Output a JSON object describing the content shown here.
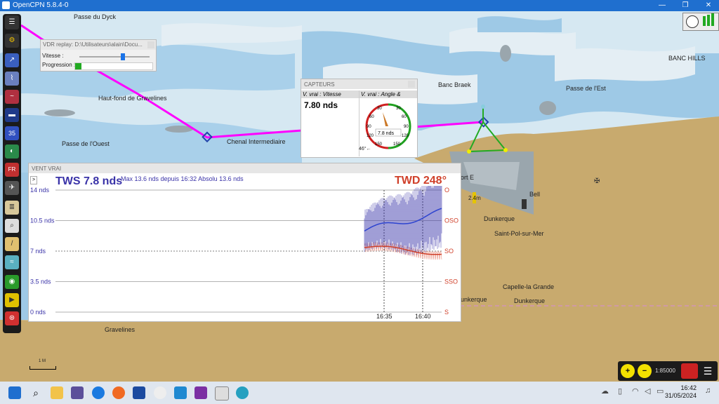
{
  "window": {
    "title": "OpenCPN 5.8.4-0"
  },
  "map": {
    "labels": [
      "Passe du Dyck",
      "Haut-fond de Gravelines",
      "Passe de l'Ouest",
      "Chenal Intermediaire",
      "Banc Braek",
      "Passe de l'Est",
      "BANC HILLS",
      "Dunkerque",
      "Saint-Pol-sur-Mer",
      "Capelle-la Grande",
      "Dunkerque",
      "unkerque",
      "Gravelines",
      "Bell",
      "2.4m",
      "ort E"
    ],
    "scale_bar": "1 M",
    "scale": "1:85000"
  },
  "vdr": {
    "title": "VDR replay: D:\\Utilisateurs\\alain\\Docu...",
    "speed_label": "Vitesse :",
    "progress_label": "Progression :",
    "speed_value": 0.62,
    "progress_value": 0.08
  },
  "capteurs": {
    "title": "CAPTEURS",
    "col1_header": "V. vrai : Vitesse",
    "col2_header": "V. vrai : Angle &",
    "speed_value": "7.80 nds",
    "gauge_labels": [
      "30",
      "60",
      "90",
      "120",
      "150",
      "30",
      "60",
      "90",
      "120",
      "150"
    ],
    "gauge_readout": "7.8 nds",
    "angle_readout": "46°←"
  },
  "vent": {
    "title": "VENT VRAI",
    "tws": "TWS 7.8 nds",
    "stats": "Max 13.6 nds depuis 16:32  Absolu 13.6 nds",
    "twd": "TWD 248°",
    "nav_button": ">",
    "y_labels": [
      "14 nds",
      "10.5 nds",
      "7 nds",
      "3.5 nds",
      "0 nds"
    ],
    "dir_labels": [
      "O",
      "OSO",
      "SO",
      "SSO",
      "S"
    ],
    "time_labels": [
      "16:35",
      "16:40"
    ],
    "colors": {
      "speed": "#3a33a8",
      "dir": "#d0402a"
    }
  },
  "taskbar": {
    "time": "16:42",
    "date": "31/05/2024"
  },
  "colors": {
    "route": "#ff00ff",
    "land": "#c8aa6e",
    "shallow": "#9ec9e6",
    "deep": "#e4eef4",
    "titlebar": "#1f6fcf"
  }
}
